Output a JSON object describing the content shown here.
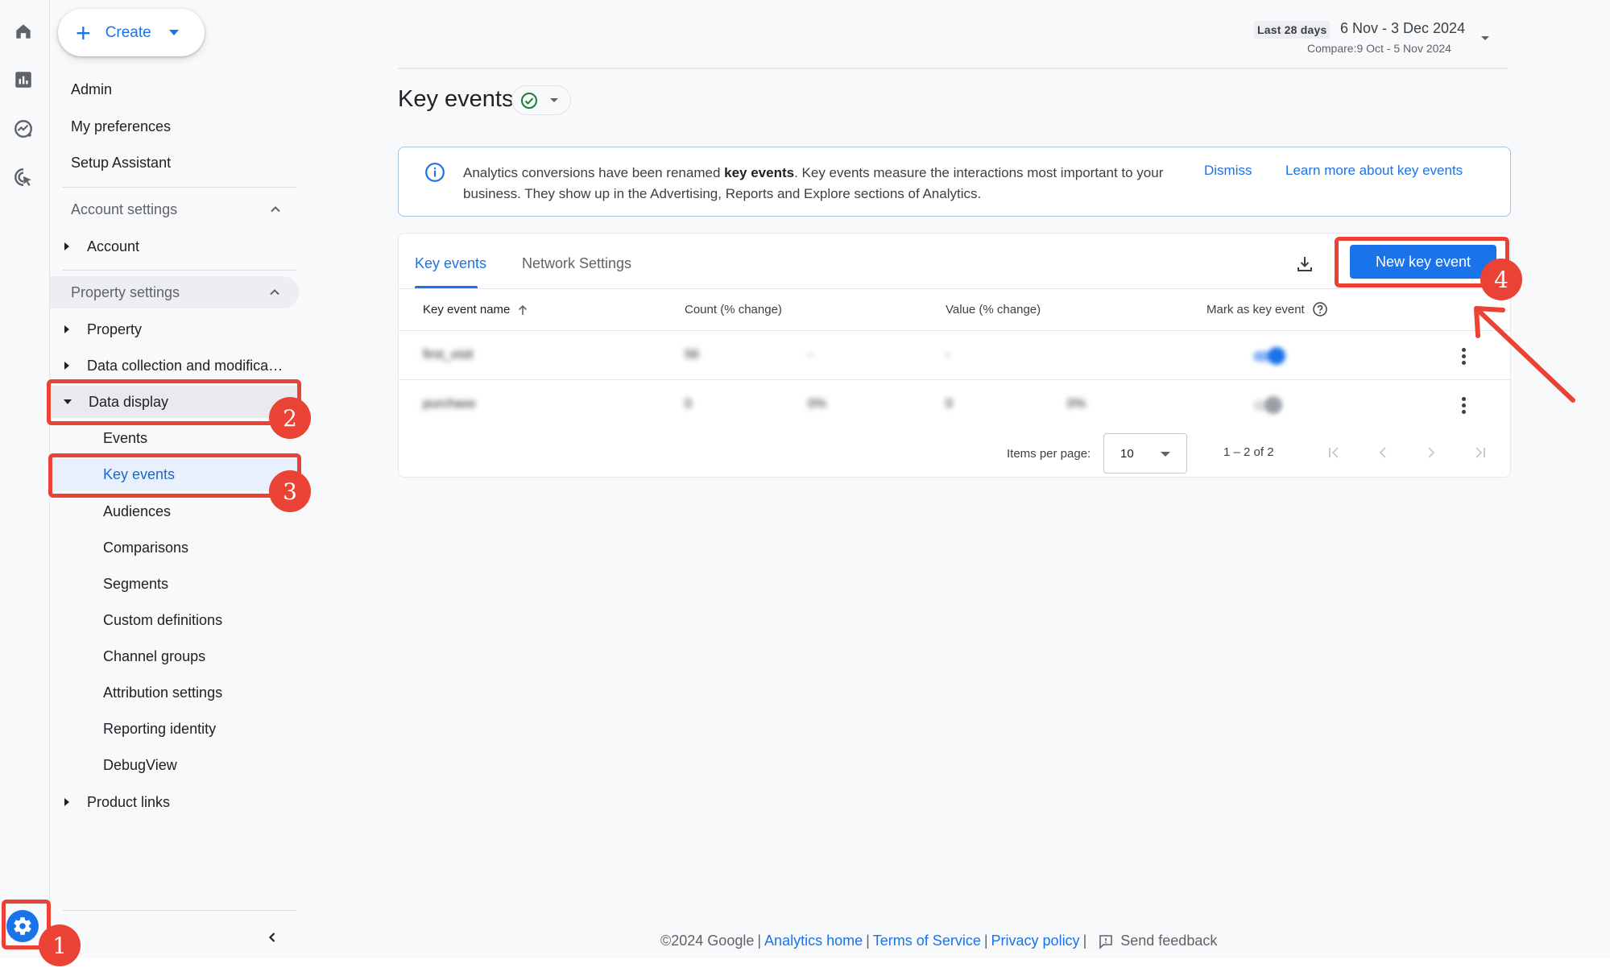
{
  "rail": {
    "icons": [
      "home-icon",
      "reports-icon",
      "explore-icon",
      "advertising-icon"
    ],
    "settings_icon": "gear-icon"
  },
  "sidebar": {
    "create_label": "Create",
    "top_items": [
      "Admin",
      "My preferences",
      "Setup Assistant"
    ],
    "account_settings": {
      "label": "Account settings",
      "items": [
        "Account"
      ]
    },
    "property_settings": {
      "label": "Property settings",
      "items": [
        "Property",
        "Data collection and modifica…",
        "Data display"
      ],
      "data_display_children": [
        "Events",
        "Key events",
        "Audiences",
        "Comparisons",
        "Segments",
        "Custom definitions",
        "Channel groups",
        "Attribution settings",
        "Reporting identity",
        "DebugView"
      ],
      "after_items": [
        "Product links"
      ]
    },
    "selected": "Key events"
  },
  "header": {
    "date_chip": "Last 28 days",
    "date_range": "6 Nov - 3 Dec 2024",
    "compare": "Compare:9 Oct - 5 Nov 2024"
  },
  "page": {
    "title": "Key events",
    "status": "check-circle-icon"
  },
  "banner": {
    "text_before": "Analytics conversions have been renamed ",
    "text_bold": "key events",
    "text_after": ". Key events measure the interactions most important to your business. They show up in the Advertising, Reports and Explore sections of Analytics.",
    "dismiss": "Dismiss",
    "learn_more": "Learn more about key events"
  },
  "card": {
    "tabs": [
      {
        "label": "Key events",
        "active": true
      },
      {
        "label": "Network Settings",
        "active": false
      }
    ],
    "new_button": "New key event",
    "columns": [
      "Key event name",
      "Count (% change)",
      "Value (% change)",
      "Mark as key event"
    ],
    "rows": [
      {
        "name": "first_visit",
        "count": "56",
        "count_change": "-",
        "value": "-",
        "value_change": "",
        "key_event": true
      },
      {
        "name": "purchase",
        "count": "0",
        "count_change": "0%",
        "value": "0",
        "value_change": "0%",
        "key_event": false
      }
    ],
    "pagination": {
      "items_per_page_label": "Items per page:",
      "items_per_page": "10",
      "range": "1 – 2 of 2"
    }
  },
  "footer": {
    "copyright": "©2024 Google",
    "links": [
      "Analytics home",
      "Terms of Service",
      "Privacy policy"
    ],
    "feedback": "Send feedback"
  },
  "annotations": [
    "1",
    "2",
    "3",
    "4"
  ],
  "colors": {
    "accent": "#1a73e8",
    "annotation": "#ea4335",
    "selected_bg": "#e8f0fe",
    "success": "#188038"
  }
}
